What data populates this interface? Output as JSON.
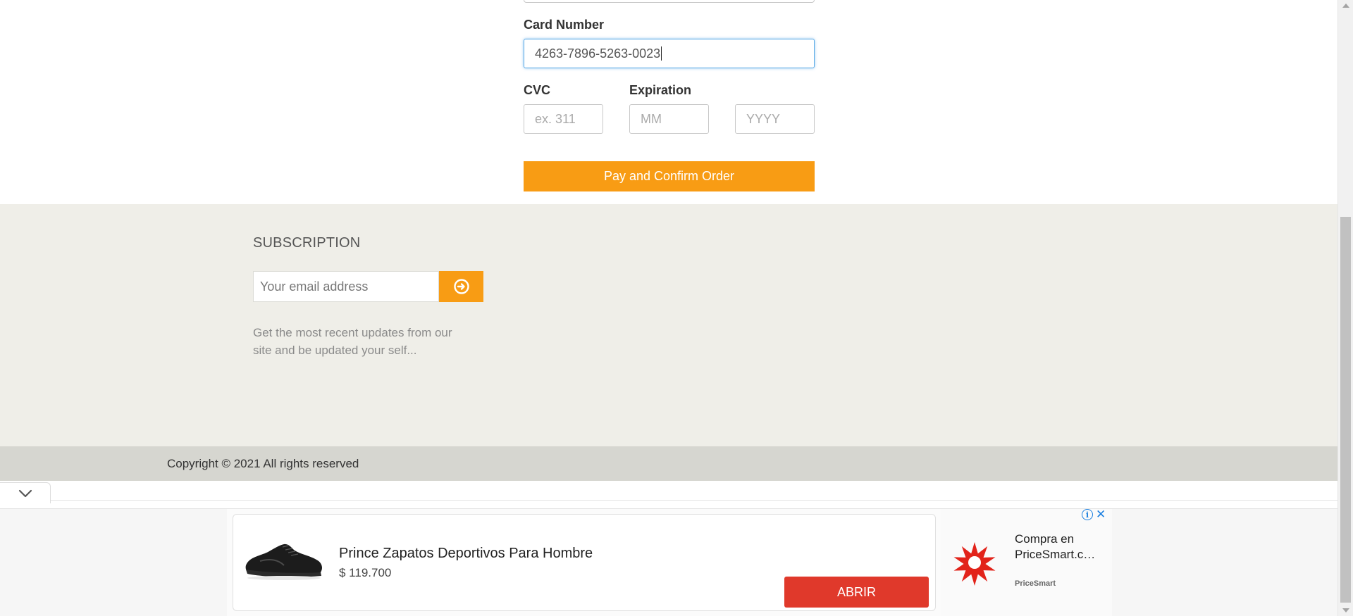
{
  "checkout": {
    "card_number_label": "Card Number",
    "card_number_value": "4263-7896-5263-0023",
    "cvc_label": "CVC",
    "cvc_placeholder": "ex. 311",
    "expiration_label": "Expiration",
    "month_placeholder": "MM",
    "year_placeholder": "YYYY",
    "pay_button": "Pay and Confirm Order"
  },
  "footer": {
    "subscription_title": "SUBSCRIPTION",
    "email_placeholder": "Your email address",
    "subscribe_icon": "arrow-circle-right-icon",
    "subscription_text": "Get the most recent updates from our site and be updated your self...",
    "copyright": "Copyright © 2021 All rights reserved"
  },
  "ad": {
    "product_title": "Prince Zapatos Deportivos Para Hombre",
    "price": "$ 119.700",
    "open_button": "ABRIR",
    "side_title": "Compra en PriceSmart.c…",
    "brand": "PriceSmart",
    "info_icon": "info-icon",
    "close_icon": "close-icon",
    "collapse_icon": "chevron-down-icon"
  },
  "colors": {
    "accent_orange": "#f89c14",
    "footer_bg": "#efeee8",
    "copyright_bg": "#d6d6d0",
    "ad_button_red": "#e0392b",
    "focus_blue": "#5aa9e6"
  }
}
